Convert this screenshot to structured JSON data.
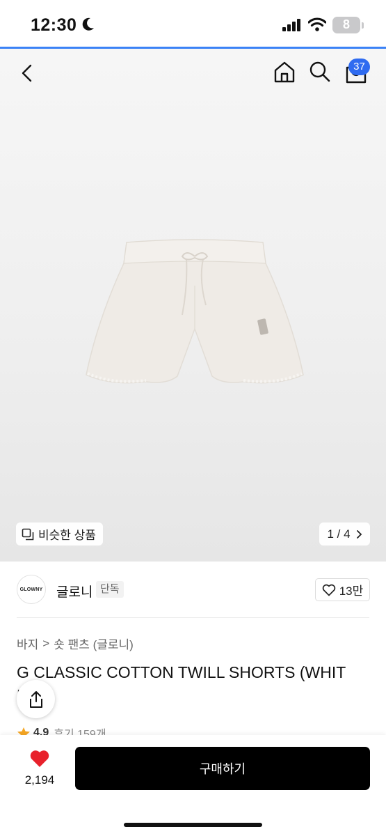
{
  "status": {
    "time": "12:30",
    "battery": "8"
  },
  "nav": {
    "cart_count": "37"
  },
  "gallery": {
    "similar_label": "비슷한 상품",
    "pager": "1 / 4"
  },
  "brand": {
    "logo_text": "GLOWNY",
    "name": "글로니",
    "tag": "단독",
    "likes": "13만"
  },
  "product": {
    "breadcrumb_category": "바지",
    "breadcrumb_separator": ">",
    "breadcrumb_sub": "숏 팬츠 (글로니)",
    "title": "G CLASSIC COTTON TWILL SHORTS (WHIT",
    "title_line2": "E)",
    "rating": "4.9",
    "reviews": "후기 159개"
  },
  "bottom": {
    "wish_count": "2,194",
    "buy_label": "구매하기"
  },
  "colors": {
    "accent_blue": "#2f6bf0",
    "heart_red": "#e8212b",
    "star_orange": "#f5a623"
  },
  "icons": [
    "moon-icon",
    "signal-icon",
    "wifi-icon",
    "back-icon",
    "home-icon",
    "search-icon",
    "shopping-bag-icon",
    "similar-icon",
    "chevron-right-icon",
    "heart-outline-icon",
    "share-icon",
    "star-icon",
    "heart-filled-icon"
  ]
}
